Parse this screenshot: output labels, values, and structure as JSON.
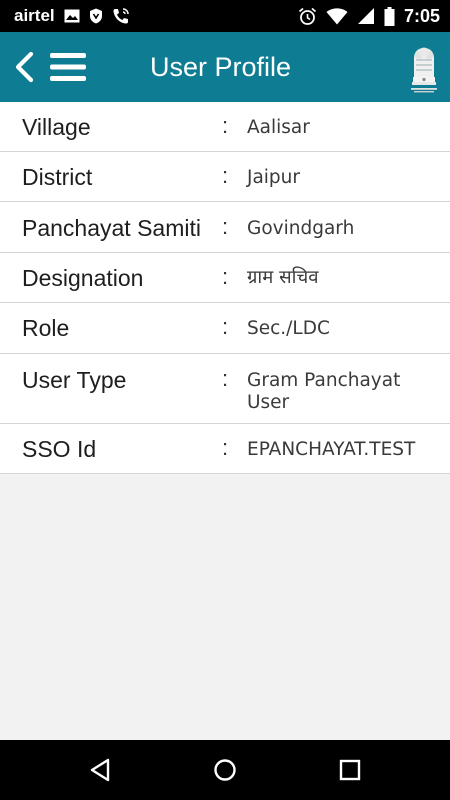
{
  "status_bar": {
    "carrier": "airtel",
    "time": "7:05",
    "left_icons": [
      "image-icon",
      "shield-icon",
      "phone-call-icon"
    ],
    "right_icons": [
      "alarm-icon",
      "wifi-icon",
      "signal-icon",
      "battery-icon"
    ]
  },
  "header": {
    "title": "User Profile",
    "back_icon": "chevron-left-icon",
    "menu_icon": "hamburger-menu-icon",
    "logo_icon": "national-emblem-icon",
    "background_color": "#0e7d94"
  },
  "profile": {
    "separator": ":",
    "rows": [
      {
        "label": "Village",
        "value": "Aalisar"
      },
      {
        "label": "District",
        "value": "Jaipur"
      },
      {
        "label": "Panchayat Samiti",
        "value": "Govindgarh"
      },
      {
        "label": "Designation",
        "value": "ग्राम सचिव"
      },
      {
        "label": "Role",
        "value": "Sec./LDC"
      },
      {
        "label": "User Type",
        "value": "Gram Panchayat User"
      },
      {
        "label": "SSO Id",
        "value": "EPANCHAYAT.TEST"
      }
    ]
  },
  "nav_bar": {
    "buttons": [
      "back-triangle-icon",
      "home-circle-icon",
      "recents-square-icon"
    ]
  }
}
